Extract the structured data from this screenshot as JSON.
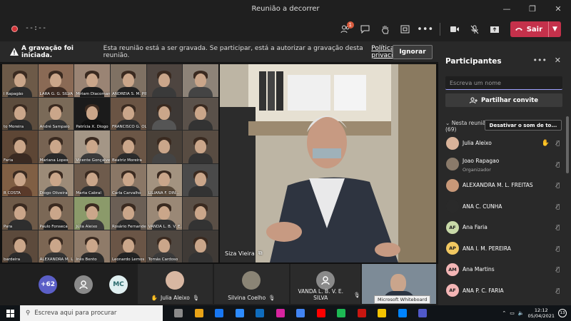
{
  "window": {
    "title": "Reunião a decorrer",
    "controls": [
      "—",
      "❐",
      "✕"
    ]
  },
  "toolbar": {
    "timer": "--:--",
    "participants_badge": "1",
    "leave_label": "Sair"
  },
  "banner": {
    "bold": "A gravação foi iniciada.",
    "message": "Esta reunião está a ser gravada. Se participar, está a autorizar a gravação desta reunião.",
    "link": "Política de privacidade",
    "ignore_label": "Ignorar"
  },
  "grid_tiles": [
    {
      "name": "l Rapagão",
      "bg": "#6d5a48",
      "shirt": "#2c2c2c"
    },
    {
      "name": "LARA G. G. SILVA",
      "bg": "#8a6a55",
      "shirt": "#3d2b22"
    },
    {
      "name": "Miriam Diacomama",
      "bg": "#9a8474",
      "shirt": "#1d1d1d"
    },
    {
      "name": "ANDREIA S. M. PINTO",
      "bg": "#7f7163",
      "shirt": "#222"
    },
    {
      "name": "",
      "bg": "#4e4540",
      "shirt": "#3a3a3a"
    },
    {
      "name": "",
      "bg": "#8d8378",
      "shirt": "#444"
    },
    {
      "name": "to Moreira",
      "bg": "#5c4c3d",
      "shirt": "#2a2a2a"
    },
    {
      "name": "André Sampaio",
      "bg": "#7a6a58",
      "shirt": "#333"
    },
    {
      "name": "Patrícia X. Diogo",
      "bg": "#1b1b1b",
      "shirt": "#111"
    },
    {
      "name": "FRANCISCO G. OLI...",
      "bg": "#6a5444",
      "shirt": "#2d2d2d"
    },
    {
      "name": "",
      "bg": "#3d3835",
      "shirt": "#555"
    },
    {
      "name": "",
      "bg": "#5a514a",
      "shirt": "#333"
    },
    {
      "name": "Faria",
      "bg": "#5d4635",
      "shirt": "#3a2a22"
    },
    {
      "name": "Mariana Lopes",
      "bg": "#776352",
      "shirt": "#2a2a2a"
    },
    {
      "name": "Vicente Gonçalves",
      "bg": "#a49686",
      "shirt": "#3b3b3b"
    },
    {
      "name": "Beatriz Moreira",
      "bg": "#6b5646",
      "shirt": "#2b2b2b"
    },
    {
      "name": "",
      "bg": "#494038",
      "shirt": "#444"
    },
    {
      "name": "",
      "bg": "#584c42",
      "shirt": "#333"
    },
    {
      "name": "R COSTA",
      "bg": "#805f44",
      "shirt": "#5a3a2a"
    },
    {
      "name": "Diogo Oliveira",
      "bg": "#9c8b78",
      "shirt": "#444"
    },
    {
      "name": "Marta Cabral",
      "bg": "#6e5b4c",
      "shirt": "#2f2f2f"
    },
    {
      "name": "Carla Carvalho",
      "bg": "#8a7766",
      "shirt": "#333"
    },
    {
      "name": "LILIANA F. DIN...",
      "bg": "#a39380",
      "shirt": "#5a4a3a"
    },
    {
      "name": "",
      "bg": "#4a4a4a",
      "shirt": "#333"
    },
    {
      "name": "Para",
      "bg": "#6e5a48",
      "shirt": "#2e2e2e"
    },
    {
      "name": "Paulo Fonseca",
      "bg": "#7b6856",
      "shirt": "#252525"
    },
    {
      "name": "Júlia Aleixo",
      "bg": "#8b9a6a",
      "shirt": "#3a3a3a"
    },
    {
      "name": "Rosário Fernandes",
      "bg": "#6b5f55",
      "shirt": "#2a2a2a"
    },
    {
      "name": "VANDA L. B. V. E...",
      "bg": "#9a8876",
      "shirt": "#333"
    },
    {
      "name": "",
      "bg": "#5a4f46",
      "shirt": "#333"
    },
    {
      "name": "bardeira",
      "bg": "#5c4a3c",
      "shirt": "#2b2b2b"
    },
    {
      "name": "ALEXANDRA M. L...",
      "bg": "#7c6653",
      "shirt": "#343434"
    },
    {
      "name": "Inês Bento",
      "bg": "#8f7b69",
      "shirt": "#2a2a2a"
    },
    {
      "name": "Leonardo Lemos",
      "bg": "#6a5546",
      "shirt": "#222"
    },
    {
      "name": "Tomás Cardoso",
      "bg": "#4f4740",
      "shirt": "#3a3a3a"
    },
    {
      "name": "",
      "bg": "#3f3a36",
      "shirt": "#333"
    }
  ],
  "speaker": {
    "name": "Siza Vieira"
  },
  "strip": {
    "more_count": "+62",
    "initials": "MC",
    "participants": [
      {
        "name": "Julia Aleixo",
        "hand": true
      },
      {
        "name": "Silvina Coelho",
        "hand": false
      },
      {
        "name": "VANDA L. B. V. E. SILVA",
        "hand": false
      }
    ]
  },
  "panel": {
    "title": "Participantes",
    "search_placeholder": "Escreva um nome",
    "share_label": "Partilhar convite",
    "section_label": "Nesta reunião",
    "section_count": "(69)",
    "mute_all_label": "Desativar o som de to...",
    "people": [
      {
        "name": "Julia Aleixo",
        "initials": "",
        "role": "",
        "color": "#d9b39a",
        "hand": true
      },
      {
        "name": "Joao Rapagao",
        "initials": "",
        "role": "Organizador",
        "color": "#8a7a6a",
        "hand": false
      },
      {
        "name": "ALEXANDRA M. L. FREITAS",
        "initials": "",
        "role": "",
        "color": "#c89878",
        "hand": false
      },
      {
        "name": "ANA C. CUNHA",
        "initials": "",
        "role": "",
        "color": "#2a2a2a",
        "hand": false
      },
      {
        "name": "Ana Faria",
        "initials": "AF",
        "role": "",
        "color": "#c8d9a8",
        "hand": false
      },
      {
        "name": "ANA I. M. PEREIRA",
        "initials": "AP",
        "role": "",
        "color": "#f2c861",
        "hand": false
      },
      {
        "name": "Ana Martins",
        "initials": "AM",
        "role": "",
        "color": "#f4b6b6",
        "hand": false
      },
      {
        "name": "ANA P. C. FARIA",
        "initials": "AF",
        "role": "",
        "color": "#f4b6b6",
        "hand": false
      }
    ]
  },
  "taskbar": {
    "search_placeholder": "Escreva aqui para procurar",
    "time": "12:12",
    "date": "05/04/2021",
    "notif_count": "13",
    "tooltip": "Microsoft Whiteboard",
    "app_colors": [
      "#8a8a8a",
      "#e8a317",
      "#1877f2",
      "#2d8cff",
      "#0f6cbd",
      "#d6249f",
      "#4285f4",
      "#ff0000",
      "#1db954",
      "#c71610",
      "#f5c400",
      "#0084ff",
      "#5059c9"
    ]
  }
}
